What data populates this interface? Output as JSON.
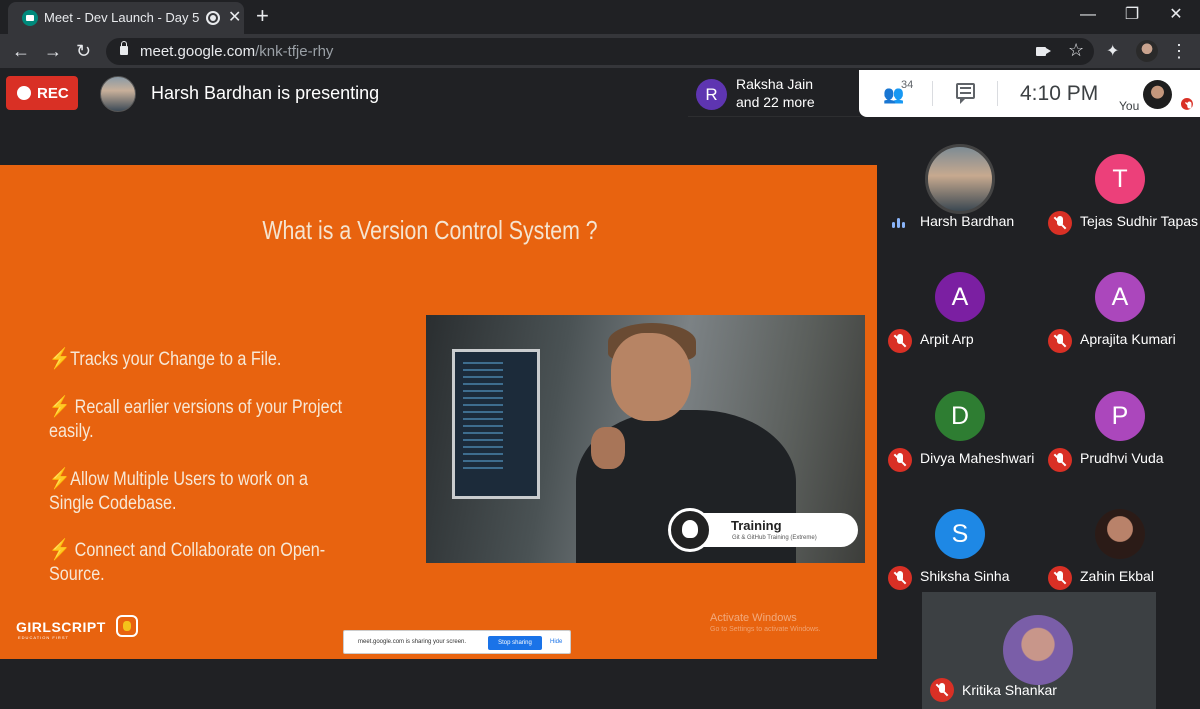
{
  "browser": {
    "tab_title": "Meet - Dev Launch - Day 5",
    "tab_close": "✕",
    "new_tab": "+",
    "url_host": "meet.google.com",
    "url_path": "/knk-tfje-rhy",
    "nav": {
      "back": "←",
      "forward": "→",
      "reload": "↻"
    },
    "window": {
      "minimize": "—",
      "maximize": "❐",
      "close": "✕"
    },
    "icons": [
      "lock-icon",
      "camera-icon",
      "star-icon",
      "extensions-icon",
      "profile-icon",
      "menu-icon"
    ]
  },
  "meet": {
    "rec_label": "REC",
    "presenting_text": "Harsh Bardhan is presenting",
    "raksha": {
      "initial": "R",
      "line1": "Raksha Jain",
      "line2": "and 22 more"
    },
    "people_count": "34",
    "clock": "4:10 PM",
    "you_label": "You"
  },
  "slide": {
    "title": "What is a Version Control System ?",
    "bullets": [
      "Tracks your Change to a File.",
      "Recall earlier versions of your Project easily.",
      "Allow Multiple Users to work on a Single Codebase.",
      "Connect and Collaborate on Open-Source."
    ],
    "video_badge_title": "Training",
    "video_badge_sub": "Git & GitHub Training (Extreme)",
    "logo_text": "GIRLSCRIPT",
    "logo_sub": "EDUCATION FIRST",
    "watermark_title": "Activate Windows",
    "watermark_sub": "Go to Settings to activate Windows.",
    "share_bar": {
      "text": "meet.google.com is sharing your screen.",
      "stop": "Stop sharing",
      "hide": "Hide"
    }
  },
  "participants": [
    {
      "name": "Harsh Bardhan",
      "initial": "",
      "color": "#5a6a78",
      "mic": "speaking"
    },
    {
      "name": "Tejas Sudhir Tapas",
      "initial": "T",
      "color": "#ec407a",
      "mic": "muted"
    },
    {
      "name": "Arpit Arp",
      "initial": "A",
      "color": "#7b1fa2",
      "mic": "muted"
    },
    {
      "name": "Aprajita Kumari",
      "initial": "A",
      "color": "#ab47bc",
      "mic": "muted"
    },
    {
      "name": "Divya Maheshwari",
      "initial": "D",
      "color": "#2e7d32",
      "mic": "muted"
    },
    {
      "name": "Prudhvi Vuda",
      "initial": "P",
      "color": "#ab47bc",
      "mic": "muted"
    },
    {
      "name": "Shiksha Sinha",
      "initial": "S",
      "color": "#1e88e5",
      "mic": "muted"
    },
    {
      "name": "Zahin Ekbal",
      "initial": "",
      "color": "#8d5b4c",
      "mic": "muted"
    },
    {
      "name": "Kritika Shankar",
      "initial": "",
      "color": "#6a4a8a",
      "mic": "muted"
    }
  ]
}
